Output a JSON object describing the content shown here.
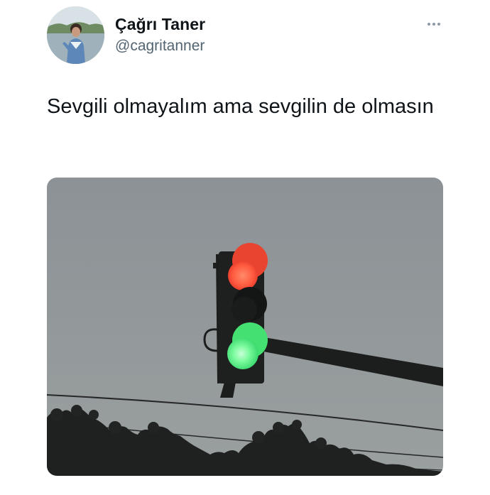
{
  "author": {
    "name": "Çağrı Taner",
    "handle": "@cagritanner",
    "avatar_icon": "profile-photo"
  },
  "tweet": {
    "text": "Sevgili olmayalım ama sevgilin de olmasın",
    "more_icon": "ellipsis-icon"
  },
  "media": {
    "subject": "traffic-light",
    "lights": [
      "red",
      "green"
    ],
    "colors": {
      "sky": "#8f9598",
      "red": "#ff6a4f",
      "green": "#5ef08a",
      "housing": "#1e1f1f"
    }
  }
}
